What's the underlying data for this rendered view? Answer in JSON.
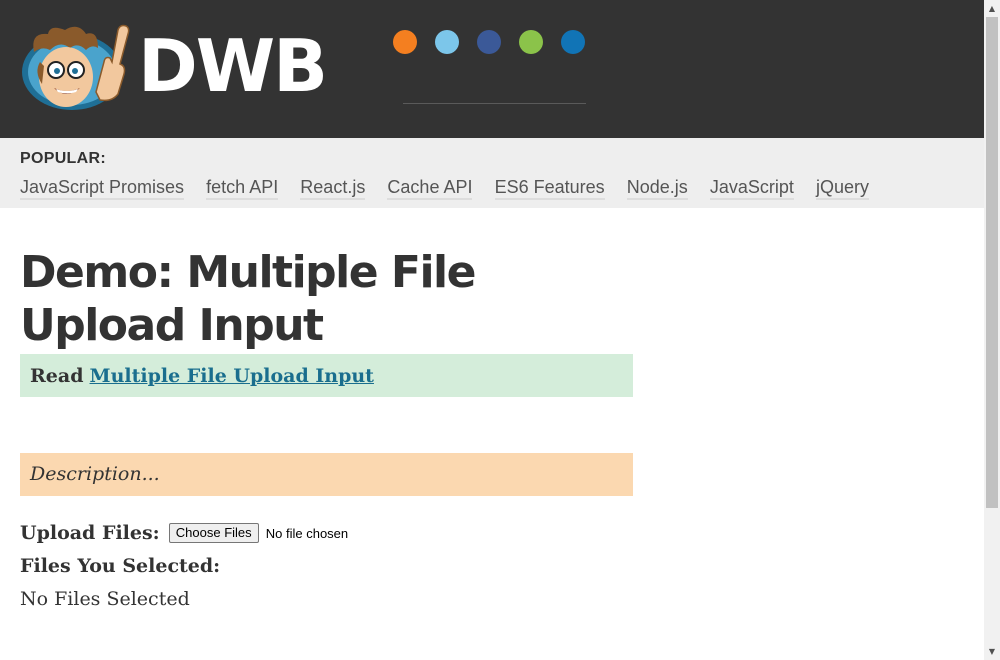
{
  "header": {
    "brand": "DWB",
    "logo_icon": "cartoon-developer-mascot-icon",
    "dots": [
      {
        "name": "orange-dot",
        "color": "#f47f20"
      },
      {
        "name": "light-blue-dot",
        "color": "#7cc6ea"
      },
      {
        "name": "navy-dot",
        "color": "#3b5998"
      },
      {
        "name": "green-dot",
        "color": "#8bc34a"
      },
      {
        "name": "blue-dot",
        "color": "#1174b6"
      }
    ]
  },
  "popular": {
    "label": "POPULAR:",
    "links": [
      "JavaScript Promises",
      "fetch API",
      "React.js",
      "Cache API",
      "ES6 Features",
      "Node.js",
      "JavaScript",
      "jQuery"
    ]
  },
  "main": {
    "title": "Demo: Multiple File Upload Input",
    "read_label": "Read",
    "read_link": "Multiple File Upload Input",
    "description": "Description...",
    "upload_label": "Upload Files:",
    "choose_button": "Choose Files",
    "no_file": "No file chosen",
    "selected_label": "Files You Selected:",
    "selected_value": "No Files Selected"
  },
  "colors": {
    "header_bg": "#333333",
    "popular_bg": "#eeeeee",
    "read_bg": "#d4edda",
    "link": "#1a6e8e",
    "description_bg": "#fbd8b0"
  }
}
